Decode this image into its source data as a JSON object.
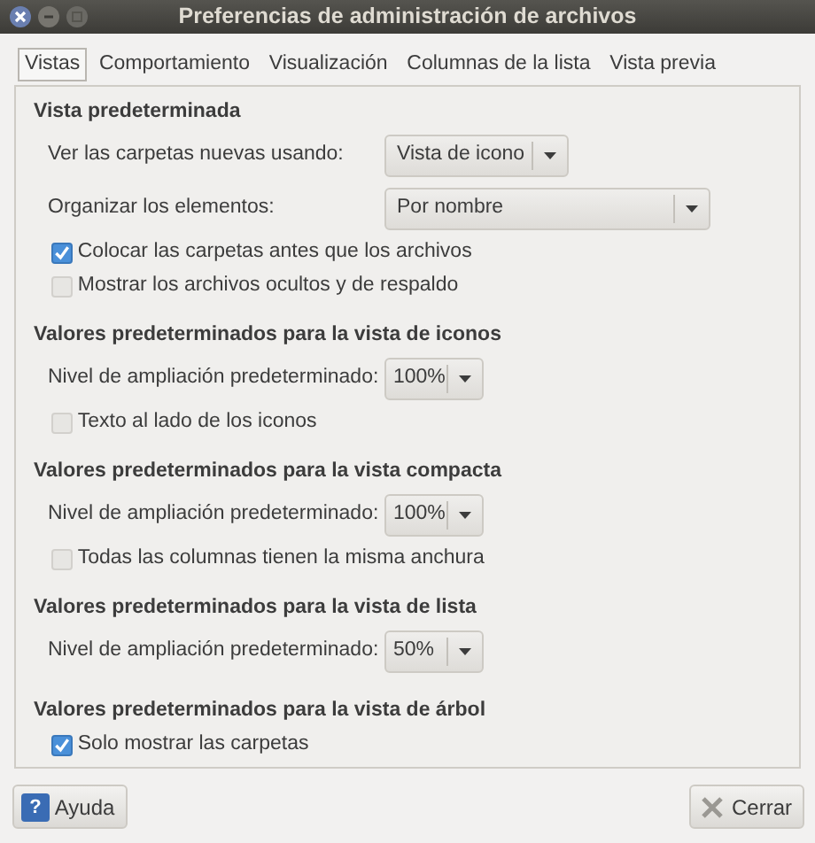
{
  "window": {
    "title": "Preferencias de administración de archivos"
  },
  "tabs": [
    {
      "label": "Vistas",
      "selected": true
    },
    {
      "label": "Comportamiento",
      "selected": false
    },
    {
      "label": "Visualización",
      "selected": false
    },
    {
      "label": "Columnas de la lista",
      "selected": false
    },
    {
      "label": "Vista previa",
      "selected": false
    }
  ],
  "sections": [
    {
      "heading": "Vista predeterminada",
      "rows": [
        {
          "kind": "combo",
          "label": "Ver las carpetas nuevas usando:",
          "value": "Vista de icono"
        },
        {
          "kind": "wide-combo",
          "label": "Organizar los elementos:",
          "value": "Por nombre"
        },
        {
          "kind": "check",
          "label": "Colocar las carpetas antes que los archivos",
          "checked": true
        },
        {
          "kind": "check",
          "label": "Mostrar los archivos ocultos y de respaldo",
          "checked": false
        }
      ]
    },
    {
      "heading": "Valores predeterminados para la vista de iconos",
      "rows": [
        {
          "kind": "combo",
          "label": "Nivel de ampliación predeterminado:",
          "value": "100%"
        },
        {
          "kind": "check",
          "label": "Texto al lado de los iconos",
          "checked": false
        }
      ]
    },
    {
      "heading": "Valores predeterminados para la vista compacta",
      "rows": [
        {
          "kind": "combo",
          "label": "Nivel de ampliación predeterminado:",
          "value": "100%"
        },
        {
          "kind": "check",
          "label": "Todas las columnas tienen la misma anchura",
          "checked": false
        }
      ]
    },
    {
      "heading": "Valores predeterminados para la vista de lista",
      "rows": [
        {
          "kind": "combo",
          "label": "Nivel de ampliación predeterminado:",
          "value": "50%"
        }
      ]
    },
    {
      "heading": "Valores predeterminados para la vista de árbol",
      "rows": [
        {
          "kind": "check",
          "label": "Solo mostrar las carpetas",
          "checked": true
        }
      ]
    }
  ],
  "buttons": [
    {
      "kind": "help",
      "label": "Ayuda",
      "glyph": "?"
    },
    {
      "kind": "close",
      "label": "Cerrar"
    }
  ]
}
